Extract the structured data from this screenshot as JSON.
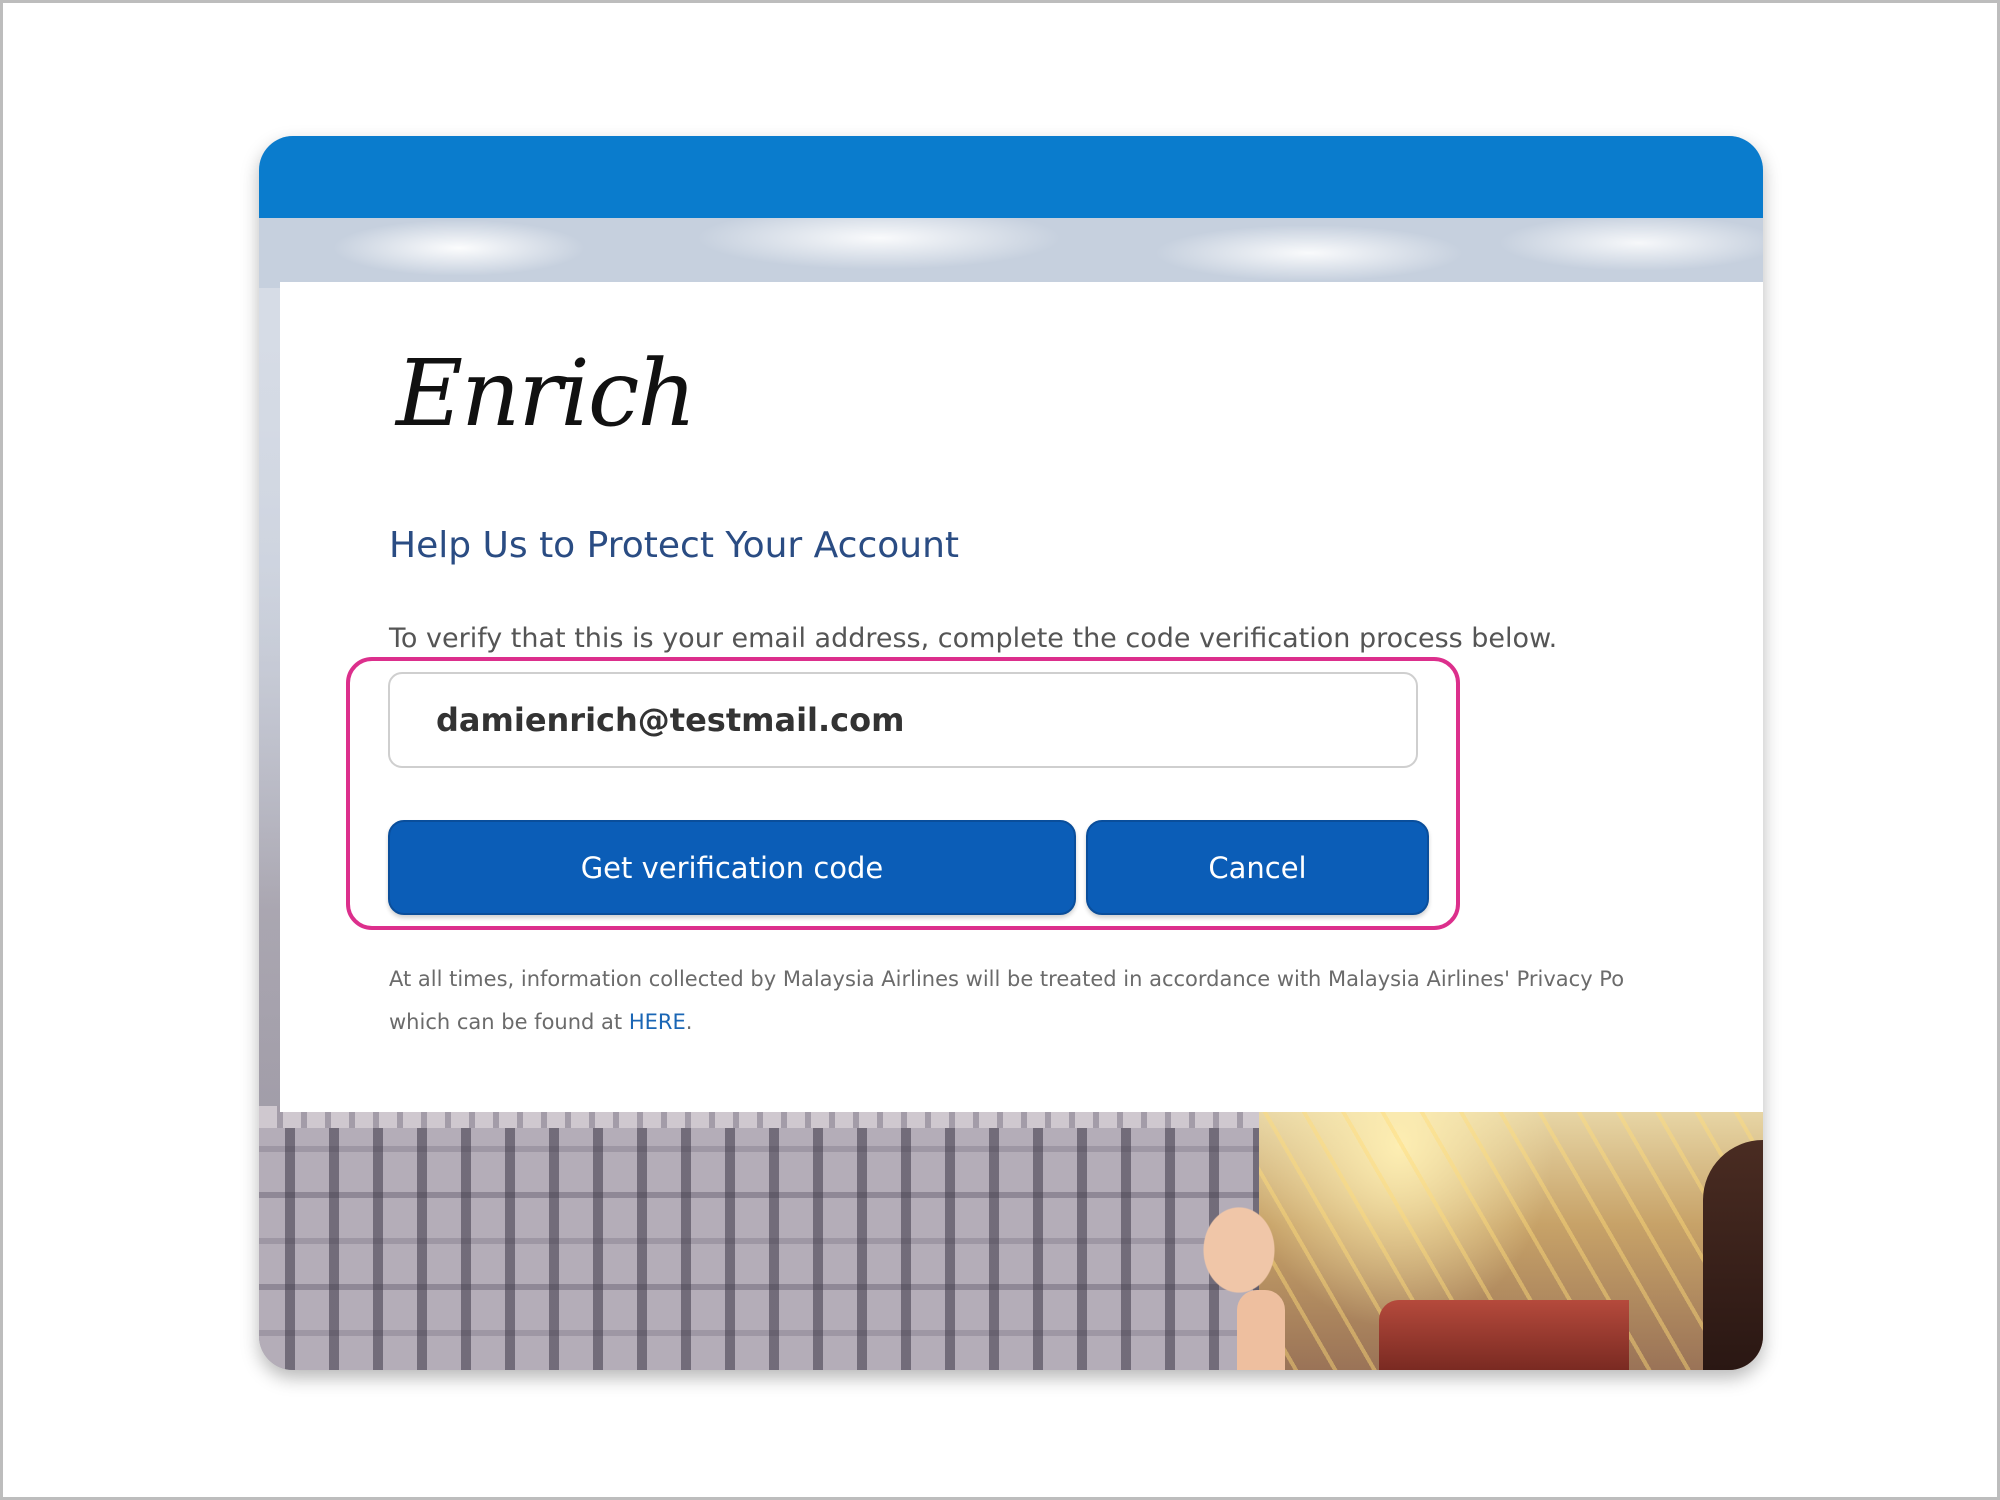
{
  "logo": {
    "text": "Enrich"
  },
  "form": {
    "headline": "Help Us to Protect Your Account",
    "instructions": "To verify that this is your email address, complete the code verification process below.",
    "email_value": "damienrich@testmail.com",
    "get_code_label": "Get verification code",
    "cancel_label": "Cancel"
  },
  "legal": {
    "line1": "At all times, information collected by Malaysia Airlines will be treated in accordance with Malaysia Airlines' Privacy Po",
    "line2_prefix": "which can be found at ",
    "link_text": "HERE",
    "line2_suffix": "."
  },
  "colors": {
    "top_bar": "#0a7ccd",
    "button": "#0b5db7",
    "headline": "#2a4c83",
    "highlight": "#dc2f8c",
    "link": "#1a66b5"
  }
}
